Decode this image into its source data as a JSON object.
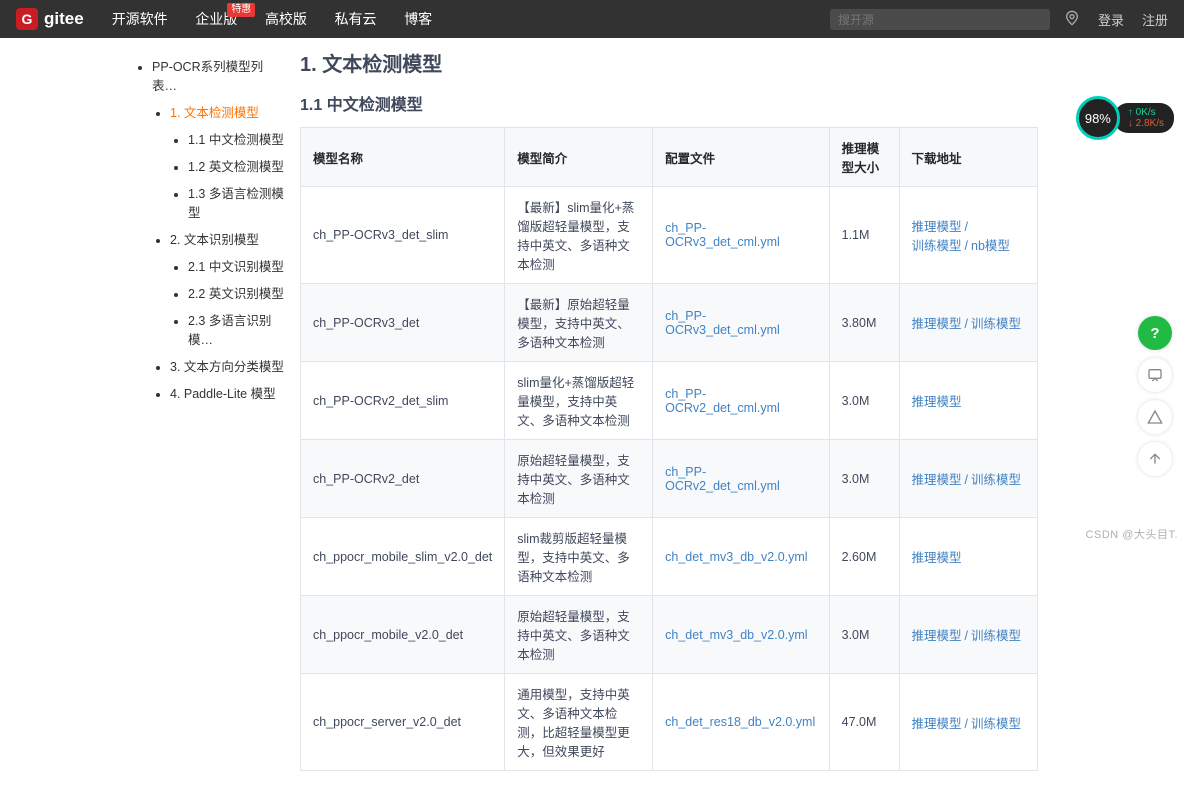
{
  "header": {
    "logo_letter": "G",
    "logo_text": "gitee",
    "nav": [
      "开源软件",
      "企业版",
      "高校版",
      "私有云",
      "博客"
    ],
    "nav_badge": "特惠",
    "search_placeholder": "搜开源",
    "login": "登录",
    "register": "注册"
  },
  "sidebar": {
    "items": [
      {
        "label": "PP-OCR系列模型列表…",
        "children": [
          {
            "label": "1. 文本检测模型",
            "active": true,
            "children": [
              {
                "label": "1.1 中文检测模型"
              },
              {
                "label": "1.2 英文检测模型"
              },
              {
                "label": "1.3 多语言检测模型"
              }
            ]
          },
          {
            "label": "2. 文本识别模型",
            "children": [
              {
                "label": "2.1 中文识别模型"
              },
              {
                "label": "2.2 英文识别模型"
              },
              {
                "label": "2.3 多语言识别模…"
              }
            ]
          },
          {
            "label": "3. 文本方向分类模型"
          },
          {
            "label": "4. Paddle-Lite 模型"
          }
        ]
      }
    ]
  },
  "content": {
    "h1": "1. 文本检测模型",
    "h2": "1.1 中文检测模型",
    "columns": [
      "模型名称",
      "模型简介",
      "配置文件",
      "推理模型大小",
      "下载地址"
    ],
    "rows": [
      {
        "name": "ch_PP-OCRv3_det_slim",
        "desc": "【最新】slim量化+蒸馏版超轻量模型，支持中英文、多语种文本检测",
        "cfg": "ch_PP-OCRv3_det_cml.yml",
        "size": "1.1M",
        "links": [
          "推理模型",
          "训练模型",
          "nb模型"
        ]
      },
      {
        "name": "ch_PP-OCRv3_det",
        "desc": "【最新】原始超轻量模型，支持中英文、多语种文本检测",
        "cfg": "ch_PP-OCRv3_det_cml.yml",
        "size": "3.80M",
        "links": [
          "推理模型",
          "训练模型"
        ]
      },
      {
        "name": "ch_PP-OCRv2_det_slim",
        "desc": "slim量化+蒸馏版超轻量模型，支持中英文、多语种文本检测",
        "cfg": "ch_PP-OCRv2_det_cml.yml",
        "size": "3.0M",
        "links": [
          "推理模型"
        ]
      },
      {
        "name": "ch_PP-OCRv2_det",
        "desc": "原始超轻量模型，支持中英文、多语种文本检测",
        "cfg": "ch_PP-OCRv2_det_cml.yml",
        "size": "3.0M",
        "links": [
          "推理模型",
          "训练模型"
        ]
      },
      {
        "name": "ch_ppocr_mobile_slim_v2.0_det",
        "desc": "slim裁剪版超轻量模型，支持中英文、多语种文本检测",
        "cfg": "ch_det_mv3_db_v2.0.yml",
        "size": "2.60M",
        "links": [
          "推理模型"
        ]
      },
      {
        "name": "ch_ppocr_mobile_v2.0_det",
        "desc": "原始超轻量模型，支持中英文、多语种文本检测",
        "cfg": "ch_det_mv3_db_v2.0.yml",
        "size": "3.0M",
        "links": [
          "推理模型",
          "训练模型"
        ]
      },
      {
        "name": "ch_ppocr_server_v2.0_det",
        "desc": "通用模型，支持中英文、多语种文本检测，比超轻量模型更大，但效果更好",
        "cfg": "ch_det_res18_db_v2.0.yml",
        "size": "47.0M",
        "links": [
          "推理模型",
          "训练模型"
        ]
      }
    ]
  },
  "net": {
    "percent": "98%",
    "up": "0K/s",
    "down": "2.8K/s"
  },
  "watermark": "CSDN @大头目T."
}
